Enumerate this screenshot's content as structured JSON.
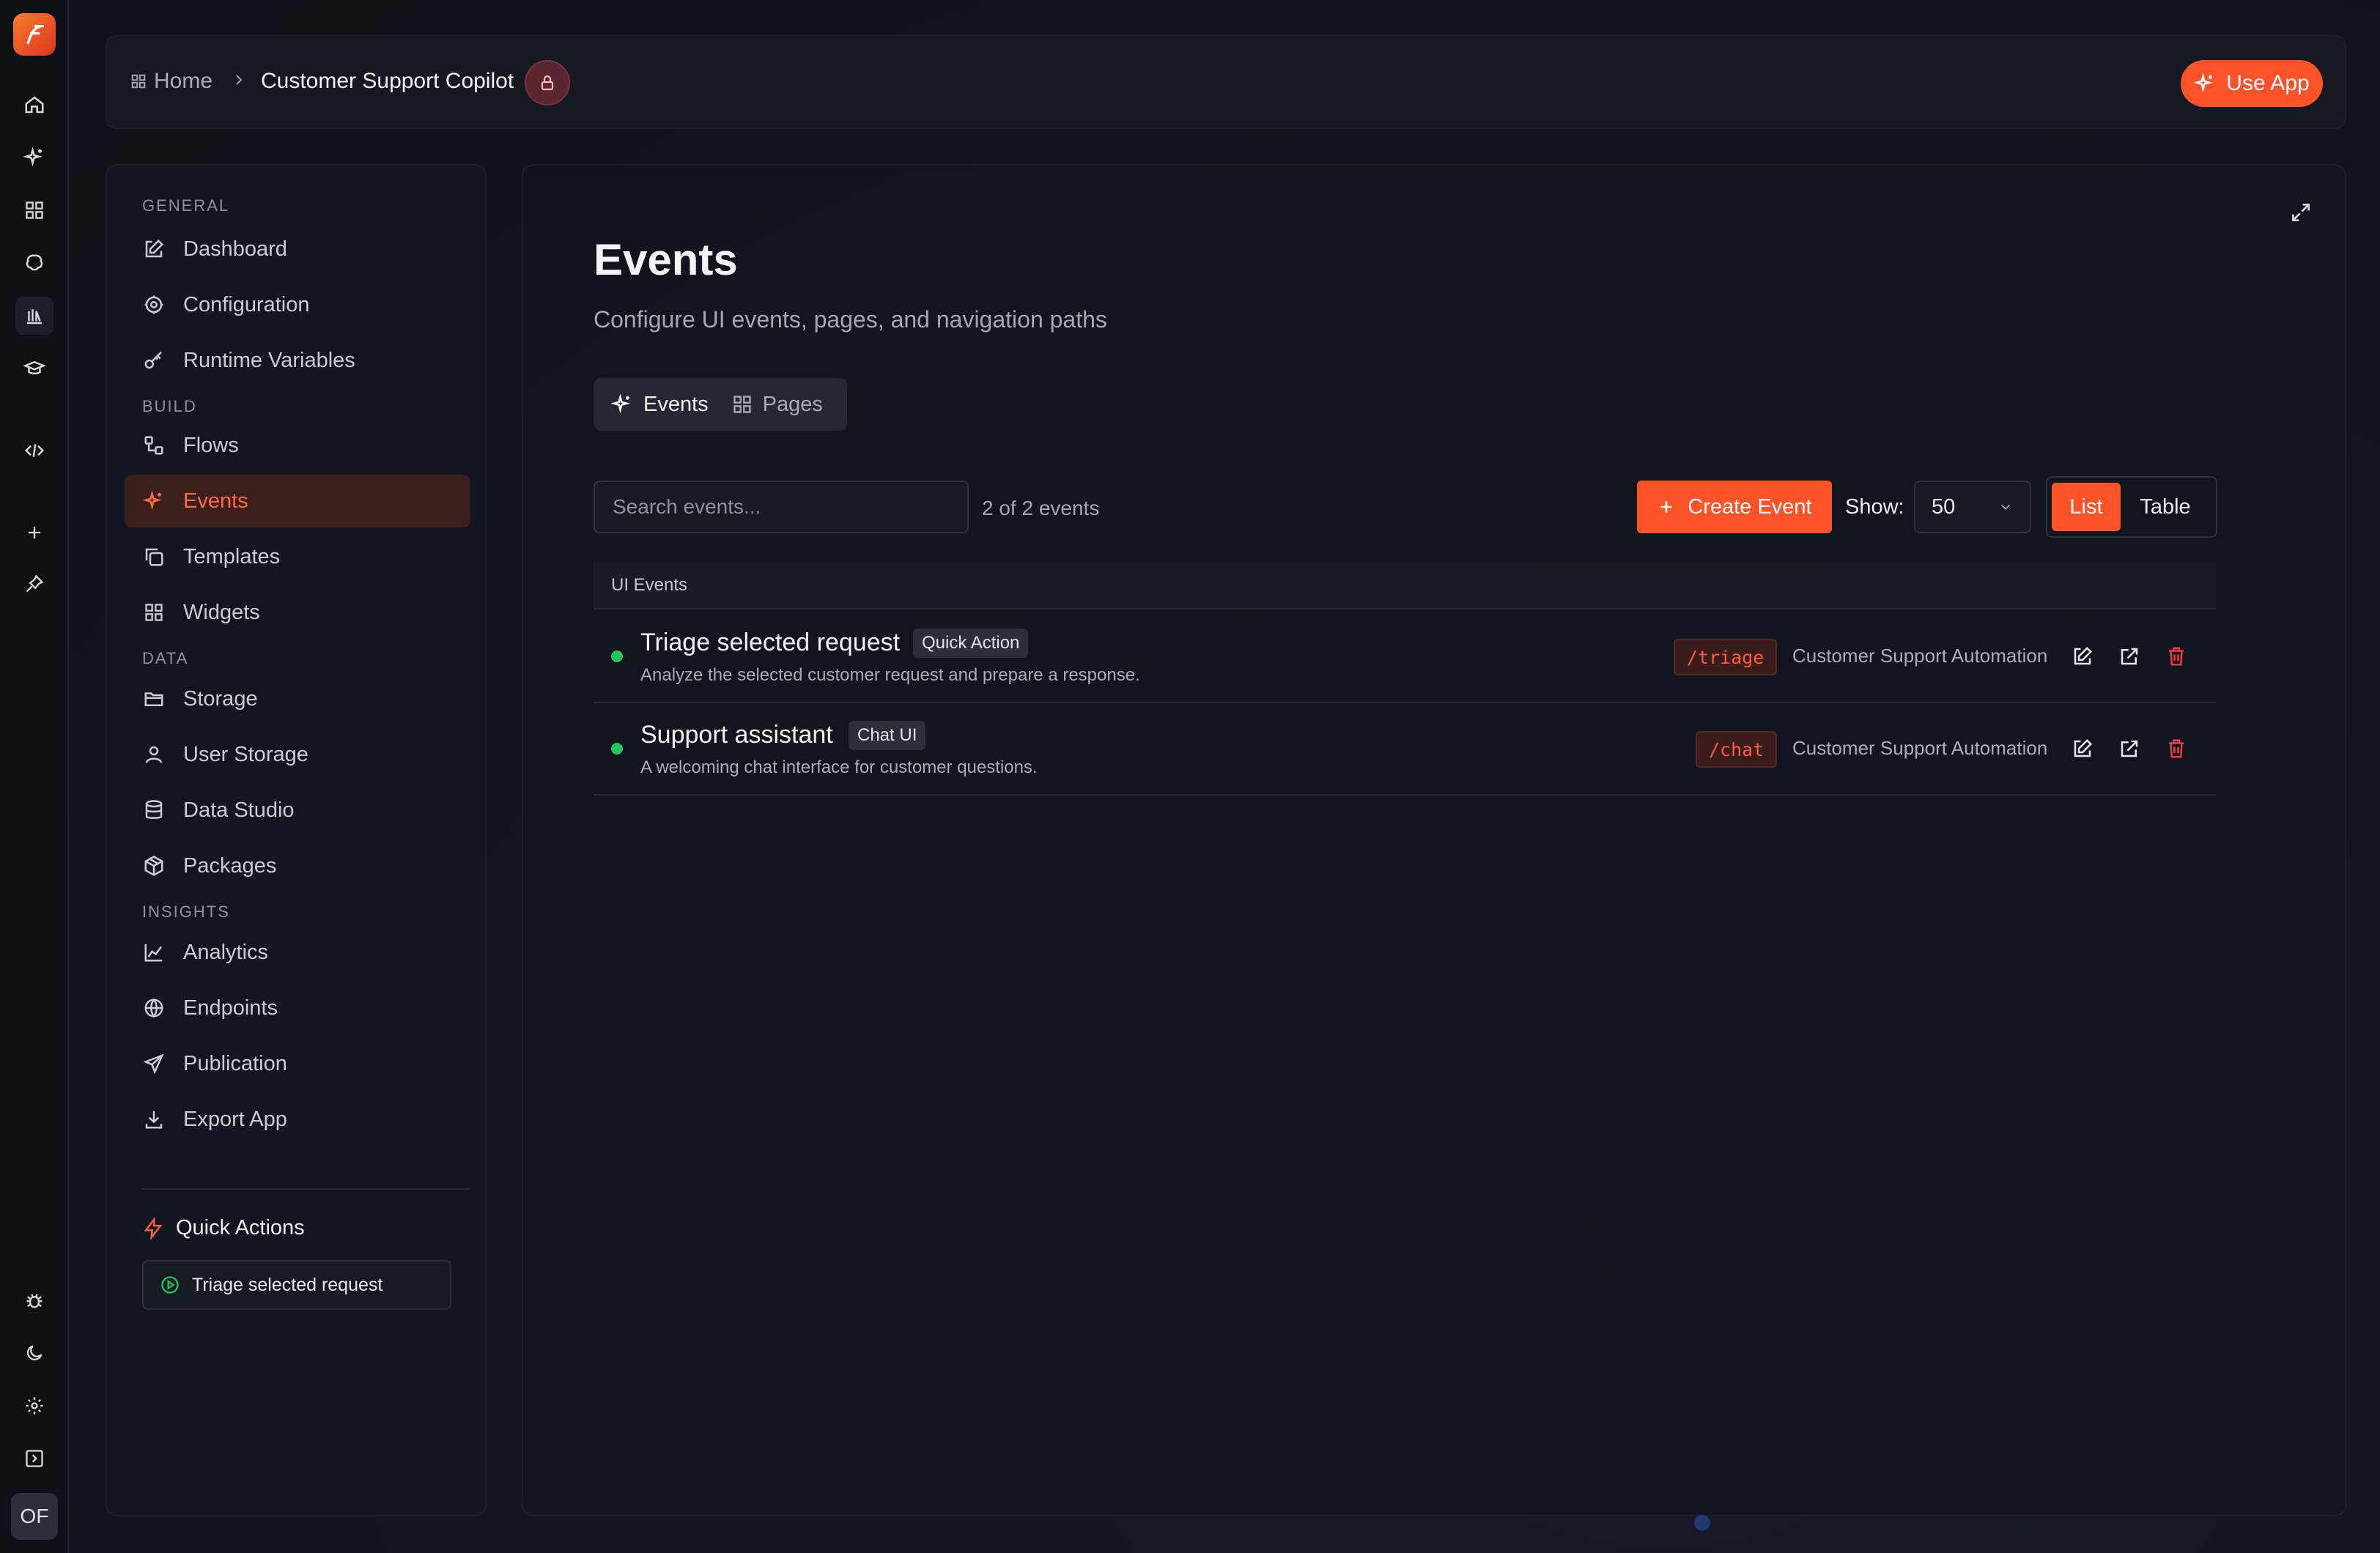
{
  "rail": {
    "logo": "app-logo",
    "avatar_initials": "OF",
    "icons": [
      "home-icon",
      "sparkles-icon",
      "grid-icon",
      "brain-icon",
      "library-icon",
      "graduation-cap-icon",
      "code-icon",
      "plus-icon",
      "pin-icon",
      "bug-icon",
      "moon-icon",
      "gear-icon",
      "panel-toggle-icon"
    ]
  },
  "breadcrumb": {
    "home": "Home",
    "current": "Customer Support Copilot"
  },
  "topbar": {
    "use_app": "Use App"
  },
  "sidebar": {
    "sections": {
      "general": "GENERAL",
      "build": "BUILD",
      "data": "DATA",
      "insights": "INSIGHTS"
    },
    "items": [
      {
        "label": "Dashboard",
        "icon": "edit-icon"
      },
      {
        "label": "Configuration",
        "icon": "gear-icon"
      },
      {
        "label": "Runtime Variables",
        "icon": "key-icon"
      },
      {
        "label": "Flows",
        "icon": "flows-icon"
      },
      {
        "label": "Events",
        "icon": "sparkles-icon"
      },
      {
        "label": "Templates",
        "icon": "copy-icon"
      },
      {
        "label": "Widgets",
        "icon": "grid-icon"
      },
      {
        "label": "Storage",
        "icon": "folder-icon"
      },
      {
        "label": "User Storage",
        "icon": "user-icon"
      },
      {
        "label": "Data Studio",
        "icon": "database-icon"
      },
      {
        "label": "Packages",
        "icon": "package-icon"
      },
      {
        "label": "Analytics",
        "icon": "chart-icon"
      },
      {
        "label": "Endpoints",
        "icon": "globe-icon"
      },
      {
        "label": "Publication",
        "icon": "send-icon"
      },
      {
        "label": "Export App",
        "icon": "download-icon"
      }
    ],
    "active": "Events",
    "quick_actions": {
      "title": "Quick Actions",
      "items": [
        "Triage selected request"
      ]
    }
  },
  "main": {
    "title": "Events",
    "subtitle": "Configure UI events, pages, and navigation paths",
    "tabs": [
      {
        "label": "Events",
        "active": true
      },
      {
        "label": "Pages",
        "active": false
      }
    ],
    "search_placeholder": "Search events...",
    "count": "2 of 2 events",
    "create_label": "Create Event",
    "show_label": "Show:",
    "show_value": "50",
    "view_list": "List",
    "view_table": "Table",
    "table_header": "UI Events",
    "events": [
      {
        "name": "Triage selected request",
        "tag": "Quick Action",
        "description": "Analyze the selected customer request and prepare a response.",
        "path": "/triage",
        "flow": "Customer Support Automation",
        "status_color": "#22c55e"
      },
      {
        "name": "Support assistant",
        "tag": "Chat UI",
        "description": "A welcoming chat interface for customer questions.",
        "path": "/chat",
        "flow": "Customer Support Automation",
        "status_color": "#22c55e"
      }
    ]
  },
  "colors": {
    "accent": "#ff5229",
    "background": "#10131c",
    "status_active": "#22c55e",
    "danger": "#ef3b3b"
  }
}
